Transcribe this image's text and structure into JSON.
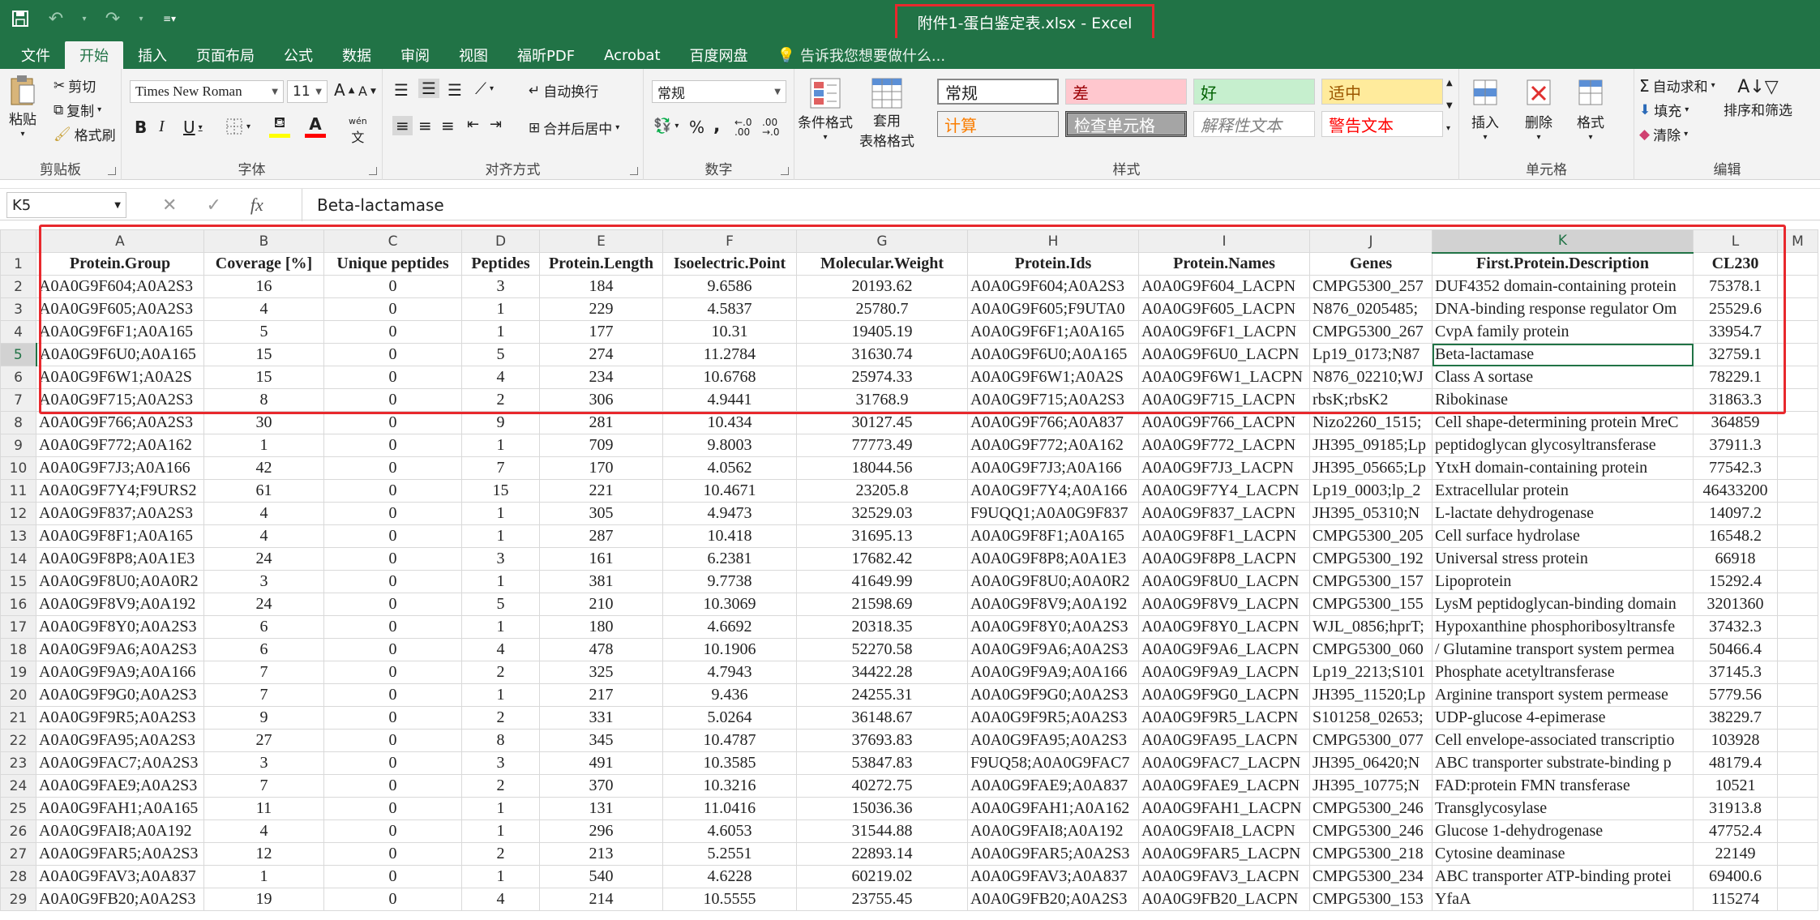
{
  "window": {
    "title": "附件1-蛋白鉴定表.xlsx - Excel"
  },
  "qat": {
    "save_icon": "save-icon",
    "undo_icon": "undo-icon",
    "redo_icon": "redo-icon",
    "customize_icon": "customize-icon"
  },
  "tabs": [
    "文件",
    "开始",
    "插入",
    "页面布局",
    "公式",
    "数据",
    "审阅",
    "视图",
    "福昕PDF",
    "Acrobat",
    "百度网盘"
  ],
  "active_tab": "开始",
  "tell_me": "告诉我您想要做什么...",
  "clipboard": {
    "paste": "粘贴",
    "cut": "剪切",
    "copy": "复制",
    "format_painter": "格式刷",
    "label": "剪贴板"
  },
  "font": {
    "name": "Times New Roman",
    "size": "11",
    "bold": "B",
    "italic": "I",
    "underline": "U",
    "wen": "wén",
    "label": "字体",
    "grow": "A",
    "shrink": "A"
  },
  "alignment": {
    "wrap": "自动换行",
    "merge": "合并后居中",
    "label": "对齐方式"
  },
  "number": {
    "format": "常规",
    "percent": "%",
    "comma": ",",
    "label": "数字"
  },
  "styles": {
    "conditional": "条件格式",
    "as_table_1": "套用",
    "as_table_2": "表格格式",
    "items": [
      "常规",
      "差",
      "好",
      "适中",
      "计算",
      "检查单元格",
      "解释性文本",
      "警告文本"
    ],
    "label": "样式"
  },
  "cells": {
    "insert": "插入",
    "delete": "删除",
    "format": "格式",
    "label": "单元格"
  },
  "editing": {
    "autosum": "自动求和",
    "fill": "填充",
    "clear": "清除",
    "sort": "排序和筛选",
    "label": "编辑"
  },
  "formula_bar": {
    "name_box": "K5",
    "fx": "fx",
    "value": "Beta-lactamase"
  },
  "sheet": {
    "columns": [
      "A",
      "B",
      "C",
      "D",
      "E",
      "F",
      "G",
      "H",
      "I",
      "J",
      "K",
      "L",
      "M"
    ],
    "selected_column": "K",
    "selected_row": 5,
    "rows": [
      [
        "Protein.Group",
        "Coverage [%]",
        "Unique peptides",
        "Peptides",
        "Protein.Length",
        "Isoelectric.Point",
        "Molecular.Weight",
        "Protein.Ids",
        "Protein.Names",
        "Genes",
        "First.Protein.Description",
        "CL230",
        ""
      ],
      [
        "A0A0G9F604;A0A2S3",
        "16",
        "0",
        "3",
        "184",
        "9.6586",
        "20193.62",
        "A0A0G9F604;A0A2S3",
        "A0A0G9F604_LACPN",
        "CMPG5300_257",
        "DUF4352 domain-containing protein",
        "75378.1",
        ""
      ],
      [
        "A0A0G9F605;A0A2S3",
        "4",
        "0",
        "1",
        "229",
        "4.5837",
        "25780.7",
        "A0A0G9F605;F9UTA0",
        "A0A0G9F605_LACPN",
        "N876_0205485;",
        "DNA-binding response regulator Om",
        "25529.6",
        ""
      ],
      [
        "A0A0G9F6F1;A0A165",
        "5",
        "0",
        "1",
        "177",
        "10.31",
        "19405.19",
        "A0A0G9F6F1;A0A165",
        "A0A0G9F6F1_LACPN",
        "CMPG5300_267",
        "CvpA family protein",
        "33954.7",
        ""
      ],
      [
        "A0A0G9F6U0;A0A165",
        "15",
        "0",
        "5",
        "274",
        "11.2784",
        "31630.74",
        "A0A0G9F6U0;A0A165",
        "A0A0G9F6U0_LACPN",
        "Lp19_0173;N87",
        "Beta-lactamase",
        "32759.1",
        ""
      ],
      [
        "A0A0G9F6W1;A0A2S",
        "15",
        "0",
        "4",
        "234",
        "10.6768",
        "25974.33",
        "A0A0G9F6W1;A0A2S",
        "A0A0G9F6W1_LACPN",
        "N876_02210;WJ",
        "Class A sortase",
        "78229.1",
        ""
      ],
      [
        "A0A0G9F715;A0A2S3",
        "8",
        "0",
        "2",
        "306",
        "4.9441",
        "31768.9",
        "A0A0G9F715;A0A2S3",
        "A0A0G9F715_LACPN",
        "rbsK;rbsK2",
        "Ribokinase",
        "31863.3",
        ""
      ],
      [
        "A0A0G9F766;A0A2S3",
        "30",
        "0",
        "9",
        "281",
        "10.434",
        "30127.45",
        "A0A0G9F766;A0A837",
        "A0A0G9F766_LACPN",
        "Nizo2260_1515;",
        "Cell shape-determining protein MreC",
        "364859",
        ""
      ],
      [
        "A0A0G9F772;A0A162",
        "1",
        "0",
        "1",
        "709",
        "9.8003",
        "77773.49",
        "A0A0G9F772;A0A162",
        "A0A0G9F772_LACPN",
        "JH395_09185;Lp",
        "peptidoglycan glycosyltransferase",
        "37911.3",
        ""
      ],
      [
        "A0A0G9F7J3;A0A166",
        "42",
        "0",
        "7",
        "170",
        "4.0562",
        "18044.56",
        "A0A0G9F7J3;A0A166",
        "A0A0G9F7J3_LACPN",
        "JH395_05665;Lp",
        "YtxH domain-containing protein",
        "77542.3",
        ""
      ],
      [
        "A0A0G9F7Y4;F9URS2",
        "61",
        "0",
        "15",
        "221",
        "10.4671",
        "23205.8",
        "A0A0G9F7Y4;A0A166",
        "A0A0G9F7Y4_LACPN",
        "Lp19_0003;lp_2",
        "Extracellular protein",
        "46433200",
        ""
      ],
      [
        "A0A0G9F837;A0A2S3",
        "4",
        "0",
        "1",
        "305",
        "4.9473",
        "32529.03",
        "F9UQQ1;A0A0G9F837",
        "A0A0G9F837_LACPN",
        "JH395_05310;N",
        "L-lactate dehydrogenase",
        "14097.2",
        ""
      ],
      [
        "A0A0G9F8F1;A0A165",
        "4",
        "0",
        "1",
        "287",
        "10.418",
        "31695.13",
        "A0A0G9F8F1;A0A165",
        "A0A0G9F8F1_LACPN",
        "CMPG5300_205",
        "Cell surface hydrolase",
        "16548.2",
        ""
      ],
      [
        "A0A0G9F8P8;A0A1E3",
        "24",
        "0",
        "3",
        "161",
        "6.2381",
        "17682.42",
        "A0A0G9F8P8;A0A1E3",
        "A0A0G9F8P8_LACPN",
        "CMPG5300_192",
        "Universal stress protein",
        "66918",
        ""
      ],
      [
        "A0A0G9F8U0;A0A0R2",
        "3",
        "0",
        "1",
        "381",
        "9.7738",
        "41649.99",
        "A0A0G9F8U0;A0A0R2",
        "A0A0G9F8U0_LACPN",
        "CMPG5300_157",
        "Lipoprotein",
        "15292.4",
        ""
      ],
      [
        "A0A0G9F8V9;A0A192",
        "24",
        "0",
        "5",
        "210",
        "10.3069",
        "21598.69",
        "A0A0G9F8V9;A0A192",
        "A0A0G9F8V9_LACPN",
        "CMPG5300_155",
        "LysM peptidoglycan-binding domain",
        "3201360",
        ""
      ],
      [
        "A0A0G9F8Y0;A0A2S3",
        "6",
        "0",
        "1",
        "180",
        "4.6692",
        "20318.35",
        "A0A0G9F8Y0;A0A2S3",
        "A0A0G9F8Y0_LACPN",
        "WJL_0856;hprT;",
        "Hypoxanthine phosphoribosyltransfe",
        "37432.3",
        ""
      ],
      [
        "A0A0G9F9A6;A0A2S3",
        "6",
        "0",
        "4",
        "478",
        "10.1906",
        "52270.58",
        "A0A0G9F9A6;A0A2S3",
        "A0A0G9F9A6_LACPN",
        "CMPG5300_060",
        "/ Glutamine transport system permea",
        "50466.4",
        ""
      ],
      [
        "A0A0G9F9A9;A0A166",
        "7",
        "0",
        "2",
        "325",
        "4.7943",
        "34422.28",
        "A0A0G9F9A9;A0A166",
        "A0A0G9F9A9_LACPN",
        "Lp19_2213;S101",
        "Phosphate acetyltransferase",
        "37145.3",
        ""
      ],
      [
        "A0A0G9F9G0;A0A2S3",
        "7",
        "0",
        "1",
        "217",
        "9.436",
        "24255.31",
        "A0A0G9F9G0;A0A2S3",
        "A0A0G9F9G0_LACPN",
        "JH395_11520;Lp",
        "Arginine transport system permease",
        "5779.56",
        ""
      ],
      [
        "A0A0G9F9R5;A0A2S3",
        "9",
        "0",
        "2",
        "331",
        "5.0264",
        "36148.67",
        "A0A0G9F9R5;A0A2S3",
        "A0A0G9F9R5_LACPN",
        "S101258_02653;",
        "UDP-glucose 4-epimerase",
        "38229.7",
        ""
      ],
      [
        "A0A0G9FA95;A0A2S3",
        "27",
        "0",
        "8",
        "345",
        "10.4787",
        "37693.83",
        "A0A0G9FA95;A0A2S3",
        "A0A0G9FA95_LACPN",
        "CMPG5300_077",
        "Cell envelope-associated transcriptio",
        "103928",
        ""
      ],
      [
        "A0A0G9FAC7;A0A2S3",
        "3",
        "0",
        "3",
        "491",
        "10.3585",
        "53847.83",
        "F9UQ58;A0A0G9FAC7",
        "A0A0G9FAC7_LACPN",
        "JH395_06420;N",
        "ABC transporter substrate-binding p",
        "48179.4",
        ""
      ],
      [
        "A0A0G9FAE9;A0A2S3",
        "7",
        "0",
        "2",
        "370",
        "10.3216",
        "40272.75",
        "A0A0G9FAE9;A0A837",
        "A0A0G9FAE9_LACPN",
        "JH395_10775;N",
        "FAD:protein FMN transferase",
        "10521",
        ""
      ],
      [
        "A0A0G9FAH1;A0A165",
        "11",
        "0",
        "1",
        "131",
        "11.0416",
        "15036.36",
        "A0A0G9FAH1;A0A162",
        "A0A0G9FAH1_LACPN",
        "CMPG5300_246",
        "Transglycosylase",
        "31913.8",
        ""
      ],
      [
        "A0A0G9FAI8;A0A192",
        "4",
        "0",
        "1",
        "296",
        "4.6053",
        "31544.88",
        "A0A0G9FAI8;A0A192",
        "A0A0G9FAI8_LACPN",
        "CMPG5300_246",
        "Glucose 1-dehydrogenase",
        "47752.4",
        ""
      ],
      [
        "A0A0G9FAR5;A0A2S3",
        "12",
        "0",
        "2",
        "213",
        "5.2551",
        "22893.14",
        "A0A0G9FAR5;A0A2S3",
        "A0A0G9FAR5_LACPN",
        "CMPG5300_218",
        "Cytosine deaminase",
        "22149",
        ""
      ],
      [
        "A0A0G9FAV3;A0A837",
        "1",
        "0",
        "1",
        "540",
        "4.6228",
        "60219.02",
        "A0A0G9FAV3;A0A837",
        "A0A0G9FAV3_LACPN",
        "CMPG5300_234",
        "ABC transporter ATP-binding protei",
        "69400.6",
        ""
      ],
      [
        "A0A0G9FB20;A0A2S3",
        "19",
        "0",
        "4",
        "214",
        "10.5555",
        "23755.45",
        "A0A0G9FB20;A0A2S3",
        "A0A0G9FB20_LACPN",
        "CMPG5300_153",
        "YfaA",
        "115274",
        ""
      ]
    ]
  },
  "colors": {
    "excel_green": "#217346",
    "highlight_red": "#e8282d"
  }
}
